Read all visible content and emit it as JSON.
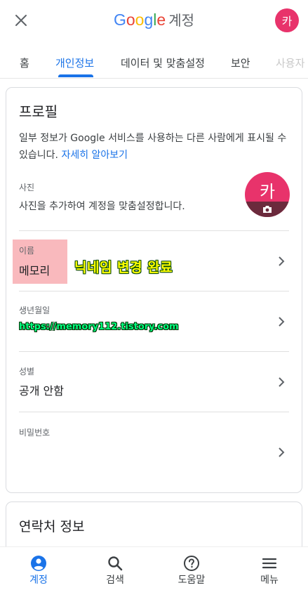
{
  "header": {
    "brand_letters": [
      "G",
      "o",
      "o",
      "g",
      "l",
      "e"
    ],
    "account_label": "계정",
    "avatar_letter": "카",
    "avatar_color": "#e8336b"
  },
  "tabs": [
    {
      "label": "홈",
      "active": false
    },
    {
      "label": "개인정보",
      "active": true
    },
    {
      "label": "데이터 및 맞춤설정",
      "active": false
    },
    {
      "label": "보안",
      "active": false
    },
    {
      "label": "사용자",
      "active": false
    }
  ],
  "profile": {
    "title": "프로필",
    "description": "일부 정보가 Google 서비스를 사용하는 다른 사람에게 표시될 수 있습니다.",
    "learn_more": "자세히 알아보기",
    "photo": {
      "label": "사진",
      "description": "사진을 추가하여 계정을 맞춤설정합니다.",
      "letter": "카"
    },
    "rows": [
      {
        "label": "이름",
        "value": "메모리"
      },
      {
        "label": "생년월일",
        "value": ""
      },
      {
        "label": "성별",
        "value": "공개 안함"
      },
      {
        "label": "비밀번호",
        "value": ""
      }
    ]
  },
  "annotations": {
    "nickname_note": "닉네임 변경 완료",
    "blog_url": "https://memory112.tistory.com"
  },
  "contact": {
    "title": "연락처 정보"
  },
  "bottom_nav": [
    {
      "label": "계정",
      "icon": "account-circle-icon",
      "active": true
    },
    {
      "label": "검색",
      "icon": "search-icon",
      "active": false
    },
    {
      "label": "도움말",
      "icon": "help-icon",
      "active": false
    },
    {
      "label": "메뉴",
      "icon": "menu-icon",
      "active": false
    }
  ],
  "colors": {
    "accent": "#1a73e8",
    "avatar": "#e8336b",
    "highlight": "#f9b9bd"
  }
}
